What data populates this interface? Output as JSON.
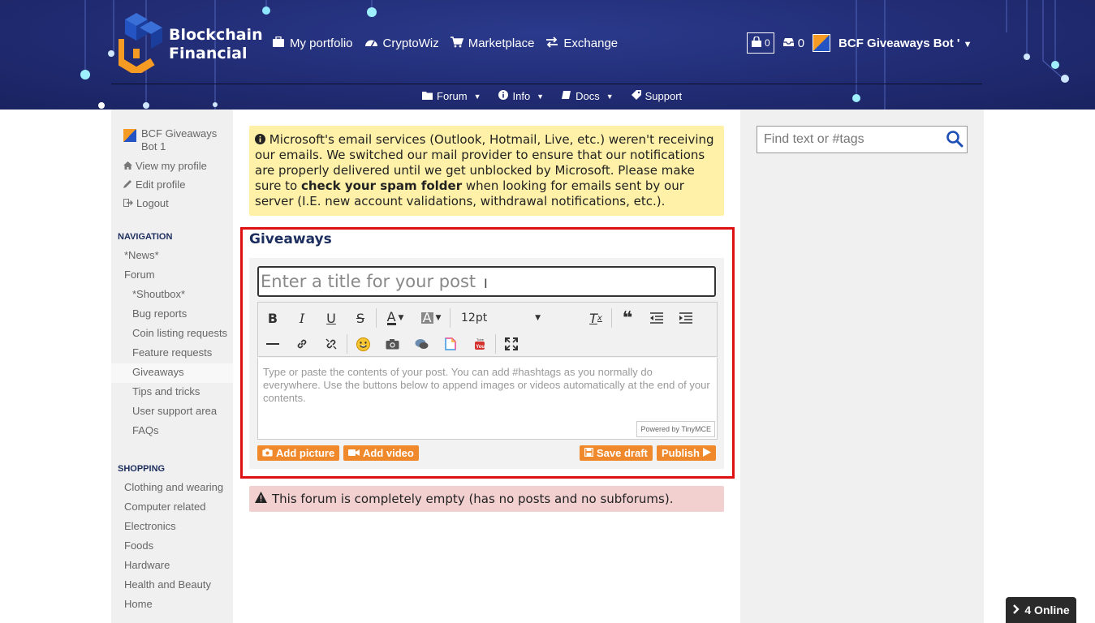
{
  "header": {
    "brand_line1": "Blockchain",
    "brand_line2": "Financial",
    "nav": [
      {
        "label": "My portfolio",
        "icon": "briefcase-icon"
      },
      {
        "label": "CryptoWiz",
        "icon": "dashboard-icon"
      },
      {
        "label": "Marketplace",
        "icon": "cart-icon"
      },
      {
        "label": "Exchange",
        "icon": "exchange-icon"
      }
    ],
    "cart_count": "0",
    "inbox_count": "0",
    "username": "BCF Giveaways Bot '",
    "subnav": [
      {
        "label": "Forum"
      },
      {
        "label": "Info"
      },
      {
        "label": "Docs"
      },
      {
        "label": "Support"
      }
    ]
  },
  "sidebar": {
    "profile_name": "BCF Giveaways Bot 1",
    "profile_links": [
      "View my profile",
      "Edit profile",
      "Logout"
    ],
    "navigation_title": "NAVIGATION",
    "navigation": [
      {
        "label": "*News*"
      },
      {
        "label": "Forum"
      },
      {
        "label": "*Shoutbox*"
      },
      {
        "label": "Bug reports"
      },
      {
        "label": "Coin listing requests"
      },
      {
        "label": "Feature requests"
      },
      {
        "label": "Giveaways"
      },
      {
        "label": "Tips and tricks"
      },
      {
        "label": "User support area"
      },
      {
        "label": "FAQs"
      }
    ],
    "shopping_title": "SHOPPING",
    "shopping": [
      {
        "label": "Clothing and wearing"
      },
      {
        "label": "Computer related"
      },
      {
        "label": "Electronics"
      },
      {
        "label": "Foods"
      },
      {
        "label": "Hardware"
      },
      {
        "label": "Health and Beauty"
      },
      {
        "label": "Home"
      }
    ]
  },
  "notice": {
    "text1": "Microsoft's email services (Outlook, Hotmail, Live, etc.) weren't receiving our emails. We switched our mail provider to ensure that our notifications are properly delivered until we get unblocked by Microsoft. Please make sure to ",
    "bold": "check your spam folder",
    "text2": " when looking for emails sent by our server (I.E. new account validations, withdrawal notifications, etc.)."
  },
  "editor": {
    "forum_title": "Giveaways",
    "title_placeholder": "Enter a title for your post",
    "font_size": "12pt",
    "body_placeholder": "Type or paste the contents of your post. You can add #hashtags as you normally do everywhere. Use the buttons below to append images or videos automatically at the end of your contents.",
    "powered_by": "Powered by TinyMCE",
    "add_picture": "Add picture",
    "add_video": "Add video",
    "save_draft": "Save draft",
    "publish": "Publish"
  },
  "empty_message": "This forum is completely empty (has no posts and no subforums).",
  "search": {
    "placeholder": "Find text or #tags"
  },
  "online": {
    "label": "4 Online"
  },
  "colors": {
    "header_bg": "#212c74",
    "accent_orange": "#f0892b",
    "notice_bg": "#fff1a8",
    "alert_bg": "#f2d0d0",
    "highlight_red": "#dd1111"
  }
}
